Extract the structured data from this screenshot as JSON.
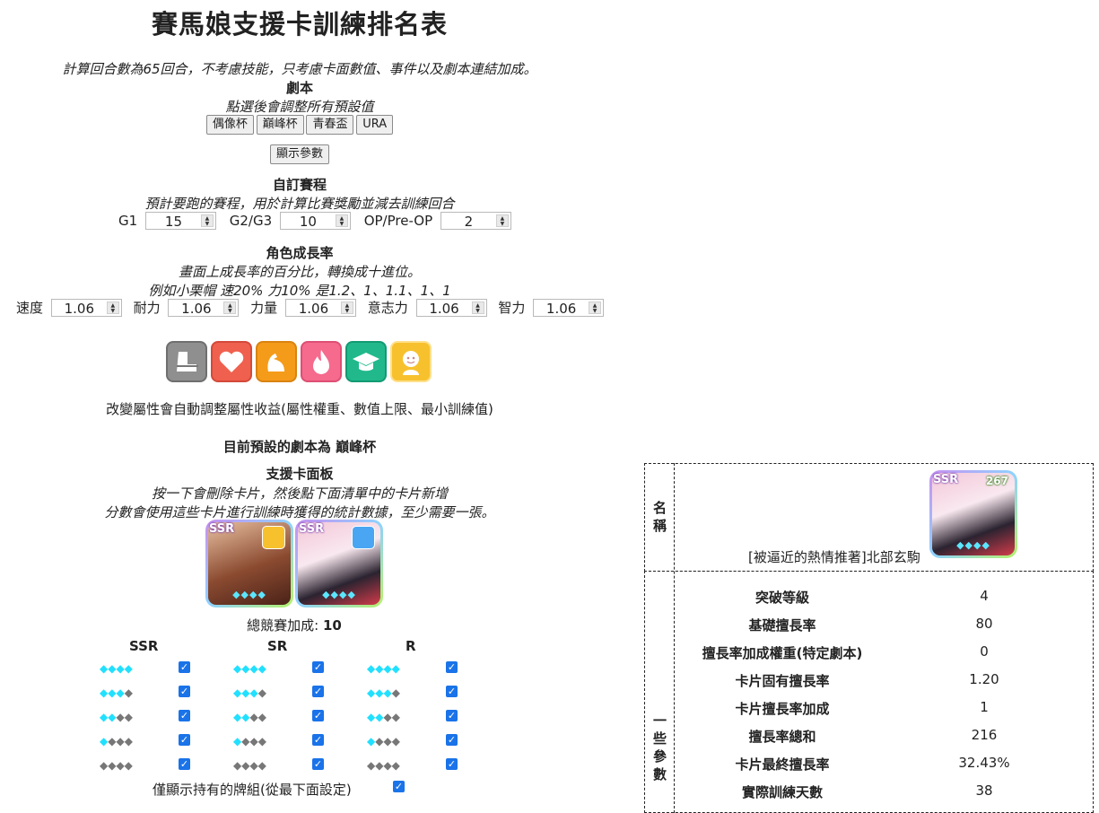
{
  "title": "賽馬娘支援卡訓練排名表",
  "intro": "計算回合數為65回合，不考慮技能，只考慮卡面數值、事件以及劇本連結加成。",
  "scenario": {
    "heading": "劇本",
    "subheading": "點選後會調整所有預設值",
    "buttons": [
      "偶像杯",
      "巔峰杯",
      "青春盃",
      "URA"
    ],
    "show_params": "顯示參數"
  },
  "custom_race": {
    "heading": "自訂賽程",
    "desc": "預計要跑的賽程，用於計算比賽獎勵並減去訓練回合",
    "fields": [
      {
        "label": "G1",
        "value": "15"
      },
      {
        "label": "G2/G3",
        "value": "10"
      },
      {
        "label": "OP/Pre-OP",
        "value": "2"
      }
    ]
  },
  "growth": {
    "heading": "角色成長率",
    "desc1": "畫面上成長率的百分比，轉換成十進位。",
    "desc2": "例如小栗帽 速20% 力10% 是1.2、1、1.1、1、1",
    "fields": [
      {
        "label": "速度",
        "value": "1.06"
      },
      {
        "label": "耐力",
        "value": "1.06"
      },
      {
        "label": "力量",
        "value": "1.06"
      },
      {
        "label": "意志力",
        "value": "1.06"
      },
      {
        "label": "智力",
        "value": "1.06"
      }
    ]
  },
  "type_icons": [
    {
      "name": "speed-icon",
      "color": "#8a8a8a"
    },
    {
      "name": "stamina-icon",
      "color": "#f0604e"
    },
    {
      "name": "power-icon",
      "color": "#f59b1a"
    },
    {
      "name": "guts-icon",
      "color": "#f56a8d"
    },
    {
      "name": "wisdom-icon",
      "color": "#21b98c"
    },
    {
      "name": "friend-icon",
      "color": "#f7c12e"
    }
  ],
  "type_note": "改變屬性會自動調整屬性收益(屬性權重、數值上限、最小訓練值)",
  "current_scenario": "目前預設的劇本為 巔峰杯",
  "deck": {
    "heading": "支援卡面板",
    "desc1": "按一下會刪除卡片，然後點下面清單中的卡片新增",
    "desc2": "分數會使用這些卡片進行訓練時獲得的統計數據，至少需要一張。",
    "cards": [
      {
        "rarity": "SSR",
        "type_icon": "friend-icon",
        "limit": "◆◆◆◆"
      },
      {
        "rarity": "SSR",
        "type_icon": "speed-icon",
        "limit": "◆◆◆◆"
      }
    ],
    "race_bonus_label": "總競賽加成:",
    "race_bonus_value": "10"
  },
  "filters": {
    "columns": [
      "SSR",
      "SR",
      "R"
    ],
    "rows": [
      {
        "filled": "◆◆◆◆",
        "empty": ""
      },
      {
        "filled": "◆◆◆",
        "empty": "◆"
      },
      {
        "filled": "◆◆",
        "empty": "◆◆"
      },
      {
        "filled": "◆",
        "empty": "◆◆◆"
      },
      {
        "filled": "",
        "empty": "◆◆◆◆"
      }
    ],
    "owned_only": "僅顯示持有的牌組(從最下面設定)"
  },
  "panel": {
    "name_label": "名稱",
    "card_name": "[被逼近的熱情推著]北部玄駒",
    "card_rarity": "SSR",
    "card_score": "267",
    "params_label": "一些參數",
    "params": [
      {
        "k": "突破等級",
        "v": "4"
      },
      {
        "k": "基礎擅長率",
        "v": "80"
      },
      {
        "k": "擅長率加成權重(特定劇本)",
        "v": "0"
      },
      {
        "k": "卡片固有擅長率",
        "v": "1.20"
      },
      {
        "k": "卡片擅長率加成",
        "v": "1"
      },
      {
        "k": "擅長率總和",
        "v": "216"
      },
      {
        "k": "卡片最終擅長率",
        "v": "32.43%"
      },
      {
        "k": "實際訓練天數",
        "v": "38"
      }
    ]
  }
}
